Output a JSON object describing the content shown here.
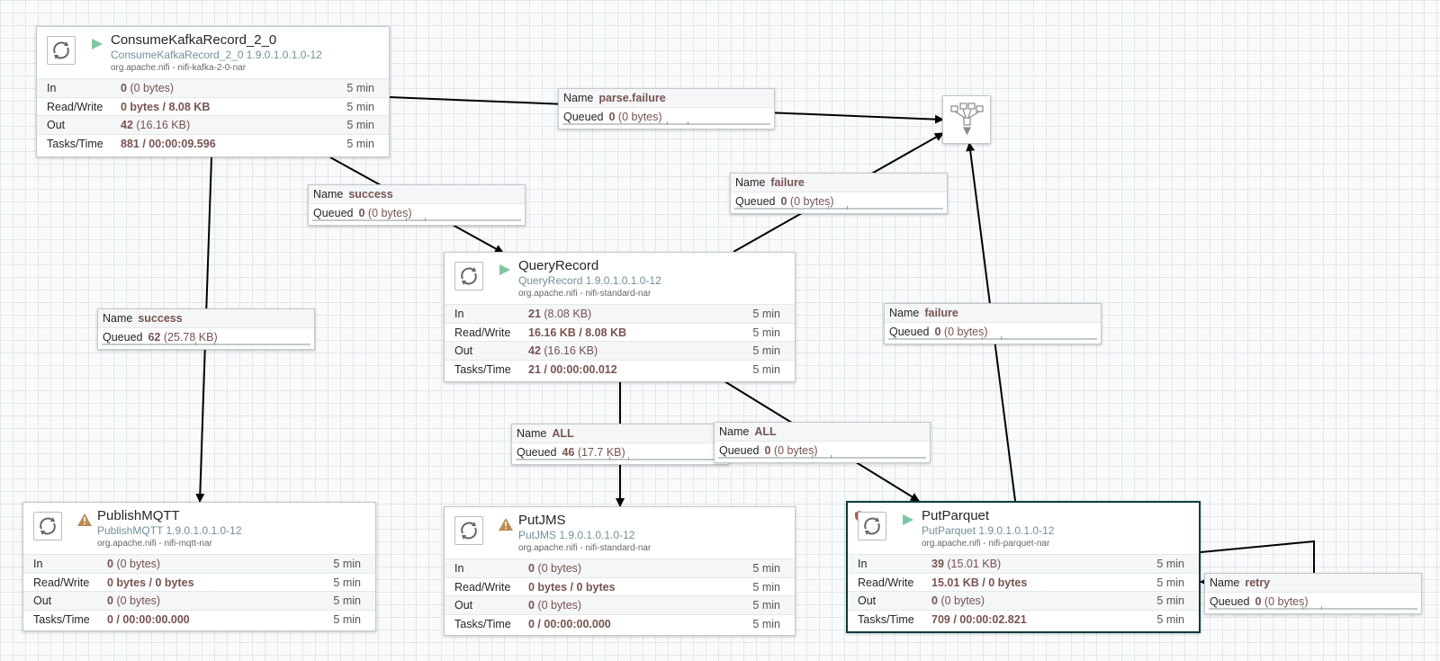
{
  "processors": {
    "consume": {
      "name": "ConsumeKafkaRecord_2_0",
      "type": "ConsumeKafkaRecord_2_0 1.9.0.1.0.1.0-12",
      "bundle": "org.apache.nifi - nifi-kafka-2-0-nar",
      "state": "running",
      "stats": [
        {
          "label": "In",
          "value": "0",
          "detail": "(0 bytes)",
          "period": "5 min"
        },
        {
          "label": "Read/Write",
          "value": "0 bytes / 8.08 KB",
          "detail": "",
          "period": "5 min"
        },
        {
          "label": "Out",
          "value": "42",
          "detail": "(16.16 KB)",
          "period": "5 min"
        },
        {
          "label": "Tasks/Time",
          "value": "881 / 00:00:09.596",
          "detail": "",
          "period": "5 min"
        }
      ]
    },
    "query": {
      "name": "QueryRecord",
      "type": "QueryRecord 1.9.0.1.0.1.0-12",
      "bundle": "org.apache.nifi - nifi-standard-nar",
      "state": "running",
      "stats": [
        {
          "label": "In",
          "value": "21",
          "detail": "(8.08 KB)",
          "period": "5 min"
        },
        {
          "label": "Read/Write",
          "value": "16.16 KB / 8.08 KB",
          "detail": "",
          "period": "5 min"
        },
        {
          "label": "Out",
          "value": "42",
          "detail": "(16.16 KB)",
          "period": "5 min"
        },
        {
          "label": "Tasks/Time",
          "value": "21 / 00:00:00.012",
          "detail": "",
          "period": "5 min"
        }
      ]
    },
    "mqtt": {
      "name": "PublishMQTT",
      "type": "PublishMQTT 1.9.0.1.0.1.0-12",
      "bundle": "org.apache.nifi - nifi-mqtt-nar",
      "state": "invalid",
      "stats": [
        {
          "label": "In",
          "value": "0",
          "detail": "(0 bytes)",
          "period": "5 min"
        },
        {
          "label": "Read/Write",
          "value": "0 bytes / 0 bytes",
          "detail": "",
          "period": "5 min"
        },
        {
          "label": "Out",
          "value": "0",
          "detail": "(0 bytes)",
          "period": "5 min"
        },
        {
          "label": "Tasks/Time",
          "value": "0 / 00:00:00.000",
          "detail": "",
          "period": "5 min"
        }
      ]
    },
    "jms": {
      "name": "PutJMS",
      "type": "PutJMS 1.9.0.1.0.1.0-12",
      "bundle": "org.apache.nifi - nifi-standard-nar",
      "state": "invalid",
      "stats": [
        {
          "label": "In",
          "value": "0",
          "detail": "(0 bytes)",
          "period": "5 min"
        },
        {
          "label": "Read/Write",
          "value": "0 bytes / 0 bytes",
          "detail": "",
          "period": "5 min"
        },
        {
          "label": "Out",
          "value": "0",
          "detail": "(0 bytes)",
          "period": "5 min"
        },
        {
          "label": "Tasks/Time",
          "value": "0 / 00:00:00.000",
          "detail": "",
          "period": "5 min"
        }
      ]
    },
    "parquet": {
      "name": "PutParquet",
      "type": "PutParquet 1.9.0.1.0.1.0-12",
      "bundle": "org.apache.nifi - nifi-parquet-nar",
      "state": "running",
      "stats": [
        {
          "label": "In",
          "value": "39",
          "detail": "(15.01 KB)",
          "period": "5 min"
        },
        {
          "label": "Read/Write",
          "value": "15.01 KB / 0 bytes",
          "detail": "",
          "period": "5 min"
        },
        {
          "label": "Out",
          "value": "0",
          "detail": "(0 bytes)",
          "period": "5 min"
        },
        {
          "label": "Tasks/Time",
          "value": "709 / 00:00:02.821",
          "detail": "",
          "period": "5 min"
        }
      ]
    }
  },
  "connections": {
    "parse_failure": {
      "name_label": "Name",
      "name": "parse.failure",
      "queued_label": "Queued",
      "count": "0",
      "size": "(0 bytes)"
    },
    "success_query": {
      "name_label": "Name",
      "name": "success",
      "queued_label": "Queued",
      "count": "0",
      "size": "(0 bytes)"
    },
    "failure_query": {
      "name_label": "Name",
      "name": "failure",
      "queued_label": "Queued",
      "count": "0",
      "size": "(0 bytes)"
    },
    "success_mqtt": {
      "name_label": "Name",
      "name": "success",
      "queued_label": "Queued",
      "count": "62",
      "size": "(25.78 KB)"
    },
    "failure_parquet": {
      "name_label": "Name",
      "name": "failure",
      "queued_label": "Queued",
      "count": "0",
      "size": "(0 bytes)"
    },
    "all_jms": {
      "name_label": "Name",
      "name": "ALL",
      "queued_label": "Queued",
      "count": "46",
      "size": "(17.7 KB)"
    },
    "all_parquet": {
      "name_label": "Name",
      "name": "ALL",
      "queued_label": "Queued",
      "count": "0",
      "size": "(0 bytes)"
    },
    "retry": {
      "name_label": "Name",
      "name": "retry",
      "queued_label": "Queued",
      "count": "0",
      "size": "(0 bytes)"
    }
  },
  "funnel": {
    "icon": "funnel-icon"
  },
  "colors": {
    "running": "#7dc7a0",
    "warning": "#ba8c55",
    "value": "#775351",
    "type_text": "#728e9b",
    "edge": "#000000"
  }
}
